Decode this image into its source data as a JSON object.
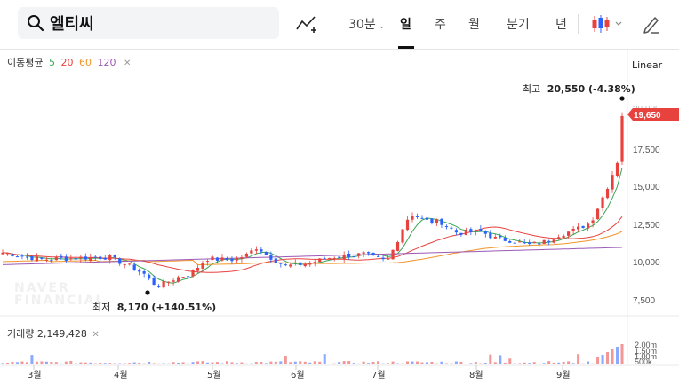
{
  "search": {
    "value": "엘티씨"
  },
  "periods": [
    {
      "label": "30분",
      "active": false,
      "dropdown": true
    },
    {
      "label": "일",
      "active": true
    },
    {
      "label": "주",
      "active": false
    },
    {
      "label": "월",
      "active": false
    },
    {
      "label": "분기",
      "active": false
    },
    {
      "label": "년",
      "active": false
    }
  ],
  "moving_average": {
    "label": "이동평균",
    "periods": [
      "5",
      "20",
      "60",
      "120"
    ],
    "colors": [
      "#3aa655",
      "#e8423f",
      "#f0952a",
      "#9b59b6"
    ]
  },
  "scale_type": "Linear",
  "annotations": {
    "high": {
      "label": "최고",
      "value": "20,550 (-4.38%)"
    },
    "low": {
      "label": "최저",
      "value": "8,170 (+140.51%)"
    }
  },
  "current_price": "19,650",
  "price_axis": [
    "20,000",
    "17,500",
    "15,000",
    "12,500",
    "10,000",
    "7,500"
  ],
  "volume": {
    "label": "거래량",
    "value": "2,149,428",
    "axis": [
      "2.00m",
      "1.50m",
      "1.00m",
      "500k"
    ]
  },
  "month_labels": [
    "3월",
    "4월",
    "5월",
    "6월",
    "7월",
    "8월",
    "9월"
  ],
  "watermark": [
    "NAVER",
    "FINANCIAL"
  ],
  "colors": {
    "up": "#e8423f",
    "down": "#2962ff"
  }
}
